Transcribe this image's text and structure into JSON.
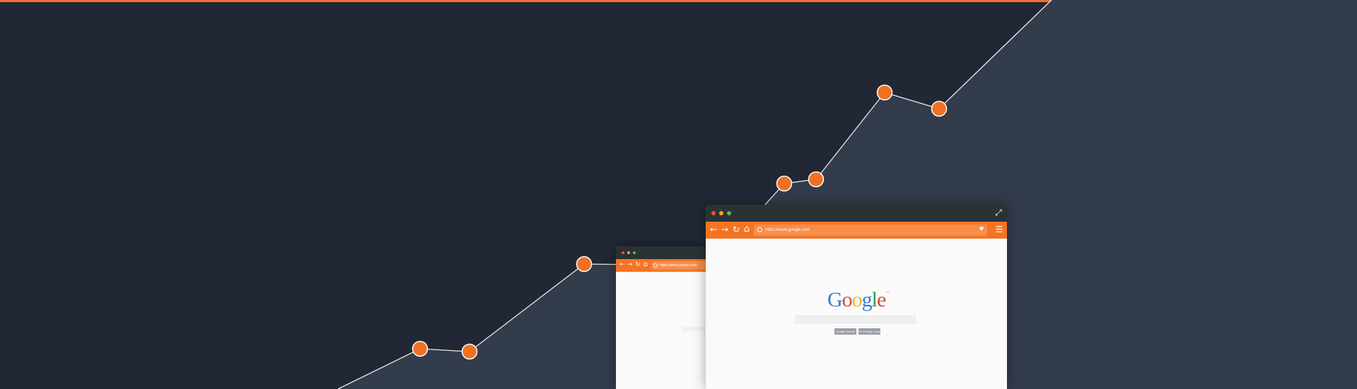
{
  "background": {
    "dark_color": "#212735",
    "light_color": "#333c4b",
    "accent_color": "#f47423",
    "line_color": "#ffffff"
  },
  "back_browser": {
    "url": "https://www.google.com",
    "traffic_lights": [
      "#e5533d",
      "#f0a338",
      "#56b85a"
    ]
  },
  "front_browser": {
    "url": "https://www.google.com",
    "traffic_lights": [
      "#e5533d",
      "#f0a338",
      "#56b85a"
    ],
    "google": {
      "logo_letters": [
        {
          "ch": "G",
          "color": "#3b7bd8"
        },
        {
          "ch": "o",
          "color": "#d64a3a"
        },
        {
          "ch": "o",
          "color": "#f2b42a"
        },
        {
          "ch": "g",
          "color": "#3b7bd8"
        },
        {
          "ch": "l",
          "color": "#2f9e55"
        },
        {
          "ch": "e",
          "color": "#d64a3a"
        }
      ],
      "trademark": "™",
      "search_button": "Google Search",
      "lucky_button": "I'm Feeling Lucky"
    }
  },
  "icons": {
    "back": "←",
    "forward": "→",
    "reload": "↻",
    "home": "⌂",
    "bookmark": "♥",
    "menu": "☰",
    "fullscreen": "⤢"
  }
}
